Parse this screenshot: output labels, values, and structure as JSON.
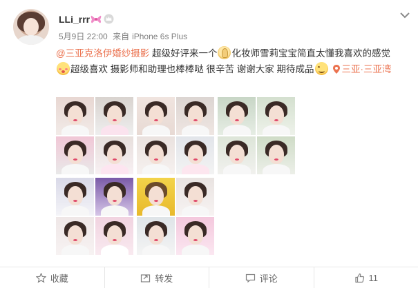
{
  "post": {
    "username": "LLi_rrr",
    "badge_icons": [
      "bow-icon",
      "crown-icon"
    ],
    "date": "5月9日 22:00",
    "source_prefix": "来自",
    "source_device": "iPhone 6s Plus",
    "text": {
      "mention": "@三亚克洛伊婚纱摄影",
      "part1": " 超级好评来一个",
      "part2": "化妆师雪莉宝宝简直太懂我喜欢的感觉",
      "part3": "超级喜欢 摄影师和助理也棒棒哒 很辛苦 谢谢大家 期待成品",
      "location": "三亚·三亚湾"
    },
    "emoji_icons": [
      "pray-emoji-icon",
      "shy-emoji-icon",
      "smile-emoji-icon"
    ]
  },
  "actions": {
    "favorite": "收藏",
    "repost": "转发",
    "comment": "评论",
    "like_count": "11"
  },
  "colors": {
    "link": "#eb7350",
    "text": "#333333",
    "meta": "#808080",
    "action_text": "#696969"
  }
}
